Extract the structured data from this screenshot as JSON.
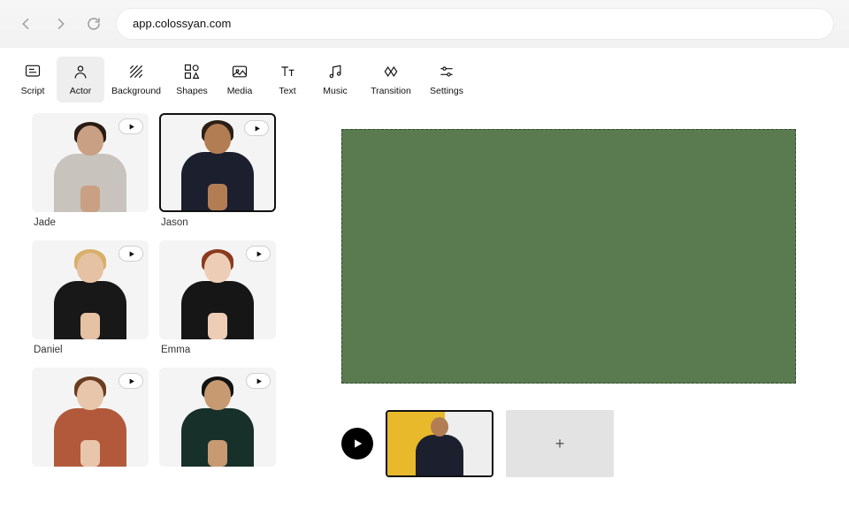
{
  "browser": {
    "url": "app.colossyan.com"
  },
  "toolbar": [
    {
      "id": "script",
      "label": "Script"
    },
    {
      "id": "actor",
      "label": "Actor"
    },
    {
      "id": "background",
      "label": "Background"
    },
    {
      "id": "shapes",
      "label": "Shapes"
    },
    {
      "id": "media",
      "label": "Media"
    },
    {
      "id": "text",
      "label": "Text"
    },
    {
      "id": "music",
      "label": "Music"
    },
    {
      "id": "transition",
      "label": "Transition"
    },
    {
      "id": "settings",
      "label": "Settings"
    }
  ],
  "toolbar_active": "actor",
  "actors": [
    {
      "name": "Jade",
      "skin": "#caa085",
      "hair": "#2a1b14",
      "shirt": "#c8c3bd",
      "selected": false
    },
    {
      "name": "Jason",
      "skin": "#b37d54",
      "hair": "#2c2017",
      "shirt": "#1c1f2e",
      "selected": true
    },
    {
      "name": "Daniel",
      "skin": "#e6c2a4",
      "hair": "#d8b06a",
      "shirt": "#181818",
      "selected": false
    },
    {
      "name": "Emma",
      "skin": "#eecdb6",
      "hair": "#8a3a1f",
      "shirt": "#161616",
      "selected": false
    },
    {
      "name": "",
      "skin": "#e8c6ac",
      "hair": "#6a3d22",
      "shirt": "#b1593a",
      "selected": false
    },
    {
      "name": "",
      "skin": "#c79a72",
      "hair": "#131313",
      "shirt": "#17302a",
      "selected": false
    }
  ],
  "canvas": {
    "background_color": "#5a7a50"
  },
  "timeline": {
    "slides": [
      {
        "bg": "#e8b92a",
        "actor_shirt": "#1c1f2e",
        "actor_skin": "#b37d54",
        "current": true
      }
    ],
    "add_label": "+"
  }
}
